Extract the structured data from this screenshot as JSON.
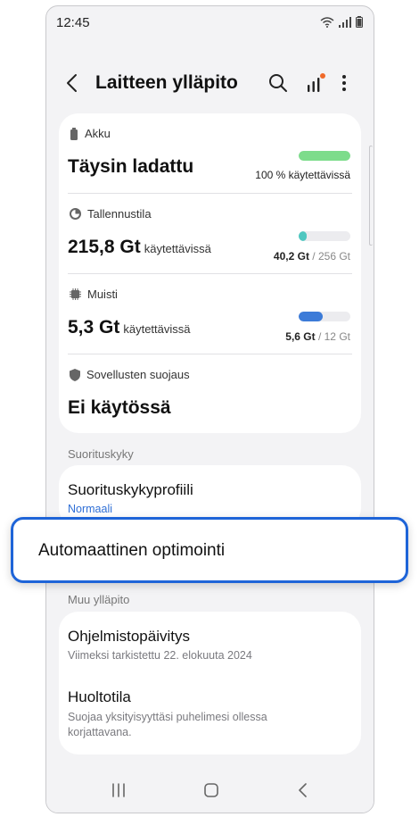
{
  "status_bar": {
    "time": "12:45"
  },
  "header": {
    "title": "Laitteen ylläpito"
  },
  "items": {
    "battery": {
      "label": "Akku",
      "value": "Täysin ladattu",
      "caption": "100 % käytettävissä",
      "level": 1.0,
      "color": "#7ddc8b"
    },
    "storage": {
      "label": "Tallennustila",
      "value": "215,8 Gt",
      "value_suffix": "käytettävissä",
      "used": "40,2 Gt",
      "total": "/ 256 Gt",
      "level": 0.16,
      "color": "#4fc7c0"
    },
    "memory": {
      "label": "Muisti",
      "value": "5,3 Gt",
      "value_suffix": "käytettävissä",
      "used": "5,6 Gt",
      "total": "/ 12 Gt",
      "level": 0.47,
      "color": "#3c7bd8"
    },
    "app_protection": {
      "label": "Sovellusten suojaus",
      "value": "Ei käytössä"
    }
  },
  "sections": {
    "performance": {
      "label": "Suorituskyky",
      "profile_title": "Suorituskykyprofiili",
      "profile_value": "Normaali"
    },
    "other": {
      "label": "Muu ylläpito",
      "software_update_title": "Ohjelmistopäivitys",
      "software_update_sub": "Viimeksi tarkistettu 22. elokuuta 2024",
      "maintenance_title": "Huoltotila",
      "maintenance_sub": "Suojaa yksityisyyttäsi puhelimesi ollessa korjattavana."
    }
  },
  "highlight": {
    "label": "Automaattinen optimointi"
  },
  "colors": {
    "accent": "#1e64d8",
    "notification_dot": "#f06a2a",
    "link": "#2f6fd6"
  },
  "icons": {
    "back": "chevron-left-icon",
    "search": "search-icon",
    "stats": "signal-bars-icon",
    "more": "more-vertical-icon",
    "battery": "battery-icon",
    "storage": "pie-chart-icon",
    "memory": "chip-icon",
    "protection": "shield-icon"
  }
}
